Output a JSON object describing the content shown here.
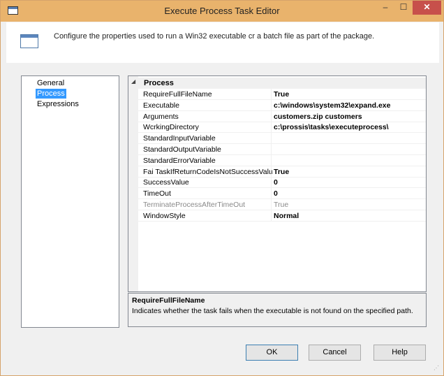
{
  "window": {
    "title": "Execute Process Task Editor",
    "min_glyph": "–",
    "max_glyph": "☐",
    "close_glyph": "✕"
  },
  "header": {
    "text": "Configure the properties used to run a Win32 executable cr a batch file as part of the package."
  },
  "nav": {
    "items": [
      {
        "label": "General",
        "selected": false
      },
      {
        "label": "Process",
        "selected": true
      },
      {
        "label": "Expressions",
        "selected": false
      }
    ]
  },
  "grid": {
    "category": "Process",
    "rows": [
      {
        "name": "RequireFullFileName",
        "value": "True",
        "disabled": false
      },
      {
        "name": "Executable",
        "value": "c:\\windows\\system32\\expand.exe",
        "disabled": false
      },
      {
        "name": "Arguments",
        "value": "customers.zip customers",
        "disabled": false
      },
      {
        "name": "WcrkingDirectory",
        "value": "c:\\prossis\\tasks\\executeprocess\\",
        "disabled": false
      },
      {
        "name": "StandardInputVariable",
        "value": "",
        "disabled": false
      },
      {
        "name": "StandardOutputVariable",
        "value": "",
        "disabled": false
      },
      {
        "name": "StandardErrorVariable",
        "value": "",
        "disabled": false
      },
      {
        "name": "Fai TaskIfReturnCodeIsNotSuccessValue",
        "value": "True",
        "disabled": false
      },
      {
        "name": "SuccessValue",
        "value": "0",
        "disabled": false
      },
      {
        "name": "TimeOut",
        "value": "0",
        "disabled": false
      },
      {
        "name": "TerminateProcessAfterTimeOut",
        "value": "True",
        "disabled": true
      },
      {
        "name": "WindowStyle",
        "value": "Normal",
        "disabled": false
      }
    ]
  },
  "description": {
    "title": "RequireFullFileName",
    "text": "Indicates whether the task fails when the executable is not found on the specified path."
  },
  "buttons": {
    "ok": "OK",
    "cancel": "Cancel",
    "help": "Help"
  },
  "colors": {
    "titlebar": "#e9b36c",
    "close_button": "#c7504b",
    "selection": "#3399ff"
  }
}
